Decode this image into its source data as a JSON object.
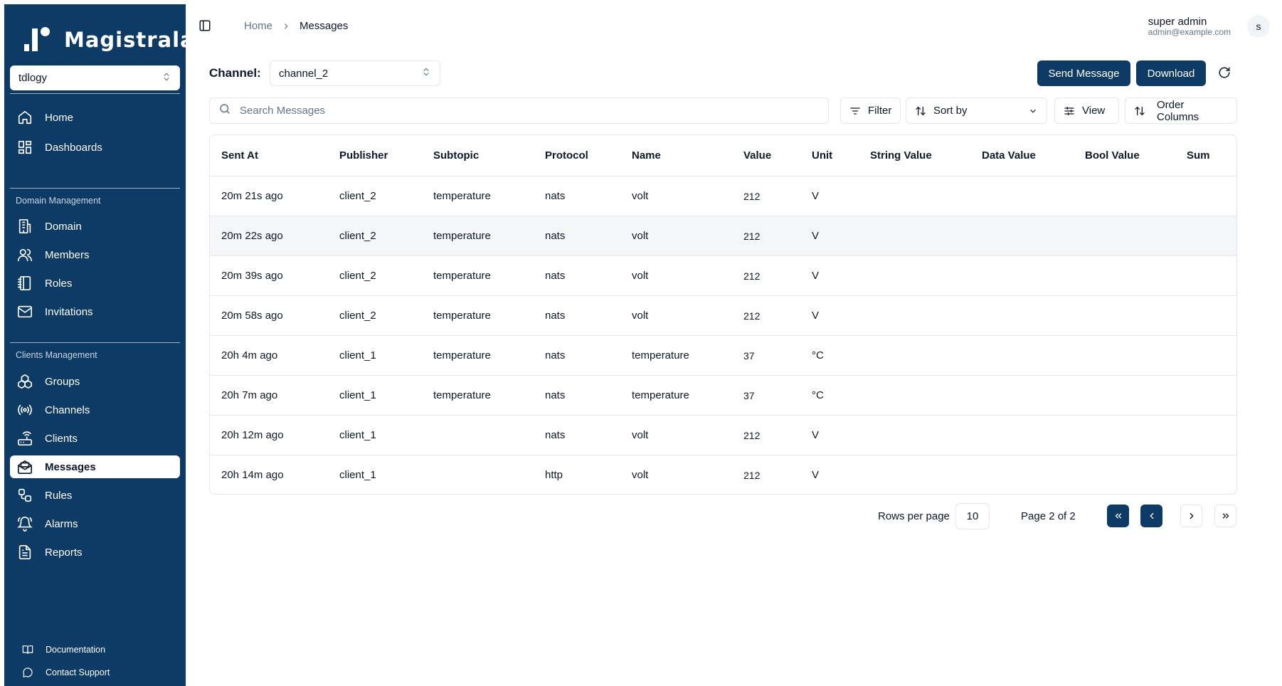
{
  "app": {
    "name": "Magistrala"
  },
  "sidebar": {
    "domain_select": "tdlogy",
    "top_items": [
      {
        "label": "Home",
        "icon": "home-icon"
      },
      {
        "label": "Dashboards",
        "icon": "dashboard-icon"
      }
    ],
    "domain_group_label": "Domain Management",
    "domain_items": [
      {
        "label": "Domain",
        "icon": "building-icon"
      },
      {
        "label": "Members",
        "icon": "users-icon"
      },
      {
        "label": "Roles",
        "icon": "notebook-icon"
      },
      {
        "label": "Invitations",
        "icon": "mail-icon"
      }
    ],
    "clients_group_label": "Clients Management",
    "clients_items": [
      {
        "label": "Groups",
        "icon": "boxes-icon"
      },
      {
        "label": "Channels",
        "icon": "radio-icon"
      },
      {
        "label": "Clients",
        "icon": "router-icon"
      },
      {
        "label": "Messages",
        "icon": "mail-open-icon",
        "active": true
      },
      {
        "label": "Rules",
        "icon": "workflow-icon"
      },
      {
        "label": "Alarms",
        "icon": "bell-icon"
      },
      {
        "label": "Reports",
        "icon": "file-text-icon"
      }
    ],
    "footer": [
      {
        "label": "Documentation",
        "icon": "book-icon"
      },
      {
        "label": "Contact Support",
        "icon": "message-circle-icon"
      }
    ]
  },
  "header": {
    "breadcrumb": {
      "home": "Home",
      "current": "Messages"
    },
    "user": {
      "name": "super admin",
      "email": "admin@example.com",
      "avatar_initial": "s"
    }
  },
  "toolbar": {
    "channel_label": "Channel:",
    "channel_value": "channel_2",
    "send_message": "Send Message",
    "download": "Download",
    "search_placeholder": "Search Messages",
    "filter": "Filter",
    "sort_by": "Sort by",
    "view": "View",
    "order_columns": "Order Columns"
  },
  "table": {
    "columns": [
      "Sent At",
      "Publisher",
      "Subtopic",
      "Protocol",
      "Name",
      "Value",
      "Unit",
      "String Value",
      "Data Value",
      "Bool Value",
      "Sum"
    ],
    "rows": [
      {
        "sent_at": "20m 21s ago",
        "publisher": "client_2",
        "subtopic": "temperature",
        "protocol": "nats",
        "name": "volt",
        "value": "212",
        "unit": "V",
        "string_value": "",
        "data_value": "",
        "bool_value": "",
        "sum": ""
      },
      {
        "sent_at": "20m 22s ago",
        "publisher": "client_2",
        "subtopic": "temperature",
        "protocol": "nats",
        "name": "volt",
        "value": "212",
        "unit": "V",
        "string_value": "",
        "data_value": "",
        "bool_value": "",
        "sum": ""
      },
      {
        "sent_at": "20m 39s ago",
        "publisher": "client_2",
        "subtopic": "temperature",
        "protocol": "nats",
        "name": "volt",
        "value": "212",
        "unit": "V",
        "string_value": "",
        "data_value": "",
        "bool_value": "",
        "sum": ""
      },
      {
        "sent_at": "20m 58s ago",
        "publisher": "client_2",
        "subtopic": "temperature",
        "protocol": "nats",
        "name": "volt",
        "value": "212",
        "unit": "V",
        "string_value": "",
        "data_value": "",
        "bool_value": "",
        "sum": ""
      },
      {
        "sent_at": "20h 4m ago",
        "publisher": "client_1",
        "subtopic": "temperature",
        "protocol": "nats",
        "name": "temperature",
        "value": "37",
        "unit": "°C",
        "string_value": "",
        "data_value": "",
        "bool_value": "",
        "sum": ""
      },
      {
        "sent_at": "20h 7m ago",
        "publisher": "client_1",
        "subtopic": "temperature",
        "protocol": "nats",
        "name": "temperature",
        "value": "37",
        "unit": "°C",
        "string_value": "",
        "data_value": "",
        "bool_value": "",
        "sum": ""
      },
      {
        "sent_at": "20h 12m ago",
        "publisher": "client_1",
        "subtopic": "",
        "protocol": "nats",
        "name": "volt",
        "value": "212",
        "unit": "V",
        "string_value": "",
        "data_value": "",
        "bool_value": "",
        "sum": ""
      },
      {
        "sent_at": "20h 14m ago",
        "publisher": "client_1",
        "subtopic": "",
        "protocol": "http",
        "name": "volt",
        "value": "212",
        "unit": "V",
        "string_value": "",
        "data_value": "",
        "bool_value": "",
        "sum": ""
      }
    ]
  },
  "pagination": {
    "rows_per_page_label": "Rows per page",
    "rows_per_page": "10",
    "page_info": "Page 2 of 2"
  },
  "colors": {
    "sidebar_bg": "#0e3a66",
    "primary": "#0e3a66",
    "border": "#e2e8f0"
  }
}
